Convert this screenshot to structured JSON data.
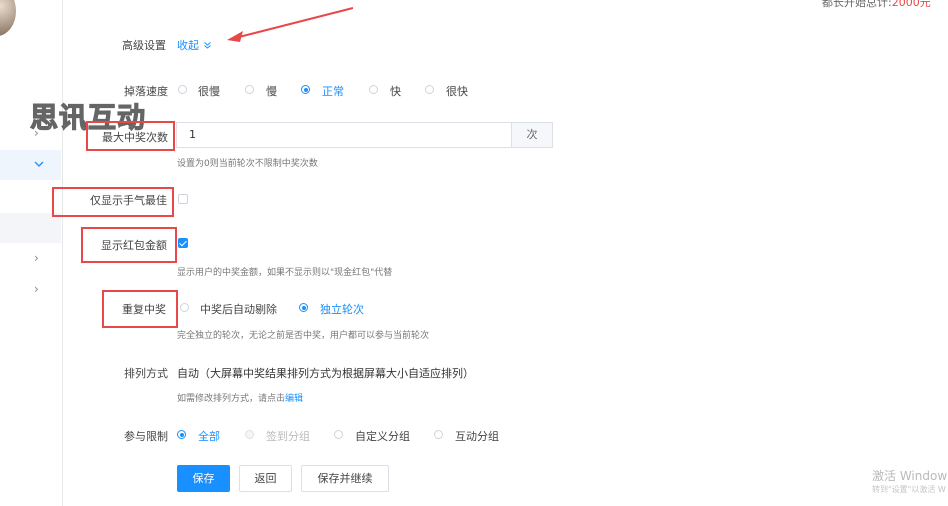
{
  "watermark": {
    "text": "思讯互动"
  },
  "top_right": {
    "text": "都长开始总计:",
    "amount": "2000元"
  },
  "advanced": {
    "label": "高级设置",
    "toggle": "收起"
  },
  "drop_speed": {
    "label": "掉落速度",
    "options": [
      "很慢",
      "慢",
      "正常",
      "快",
      "很快"
    ],
    "selected": "正常"
  },
  "max_wins": {
    "label": "最大中奖次数",
    "value": "1",
    "unit": "次",
    "hint": "设置为0则当前轮次不限制中奖次数"
  },
  "only_best": {
    "label": "仅显示手气最佳",
    "checked": false
  },
  "show_amount": {
    "label": "显示红包金额",
    "checked": true,
    "hint": "显示用户的中奖金额，如果不显示则以\"现金红包\"代替"
  },
  "repeat_win": {
    "label": "重复中奖",
    "options": [
      "中奖后自动剔除",
      "独立轮次"
    ],
    "selected": "独立轮次",
    "hint": "完全独立的轮次，无论之前是否中奖，用户都可以参与当前轮次"
  },
  "arrange": {
    "label": "排列方式",
    "value": "自动（大屏幕中奖结果排列方式为根据屏幕大小自适应排列）",
    "hint": "如需修改排列方式，请点击",
    "link": "编辑"
  },
  "participation": {
    "label": "参与限制",
    "options": [
      "全部",
      "签到分组",
      "自定义分组",
      "互动分组"
    ],
    "selected": "全部"
  },
  "buttons": {
    "save": "保存",
    "back": "返回",
    "save_continue": "保存并继续"
  },
  "os_watermark": {
    "line1": "激活 Window",
    "line2": "转到\"设置\"以激活 W"
  },
  "colors": {
    "accent": "#1890ff",
    "annotation": "#e8484a",
    "amount": "#e8484a"
  },
  "icons": {
    "chevron": "chevron-right-icon",
    "collapse": "double-chevron-down-icon"
  }
}
